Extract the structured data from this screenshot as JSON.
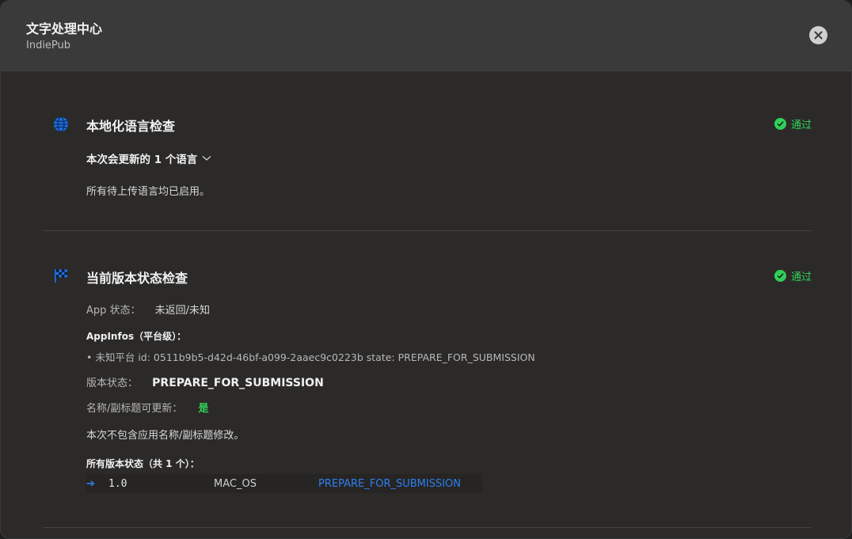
{
  "header": {
    "title": "文字处理中心",
    "subtitle": "IndiePub"
  },
  "localization": {
    "icon": "globe-icon",
    "title": "本地化语言检查",
    "status": "通过",
    "dropdown_label": "本次会更新的 1 个语言",
    "message": "所有待上传语言均已启用。"
  },
  "version_check": {
    "icon": "checkered-flag-icon",
    "title": "当前版本状态检查",
    "status": "通过",
    "app_state_label": "App 状态：",
    "app_state_value": "未返回/未知",
    "appinfos_label": "AppInfos（平台级）：",
    "appinfos_item": "• 未知平台  id: 0511b9b5-d42d-46bf-a099-2aaec9c0223b  state: PREPARE_FOR_SUBMISSION",
    "version_state_label": "版本状态：",
    "version_state_value": "PREPARE_FOR_SUBMISSION",
    "name_updatable_label": "名称/副标题可更新：",
    "name_updatable_value": "是",
    "note": "本次不包含应用名称/副标题修改。",
    "all_versions_label": "所有版本状态（共 1 个）：",
    "versions": [
      {
        "version": "1.0",
        "platform": "MAC_OS",
        "state": "PREPARE_FOR_SUBMISSION"
      }
    ]
  },
  "colors": {
    "accent_blue": "#2f7ff0",
    "success_green": "#30d158"
  }
}
